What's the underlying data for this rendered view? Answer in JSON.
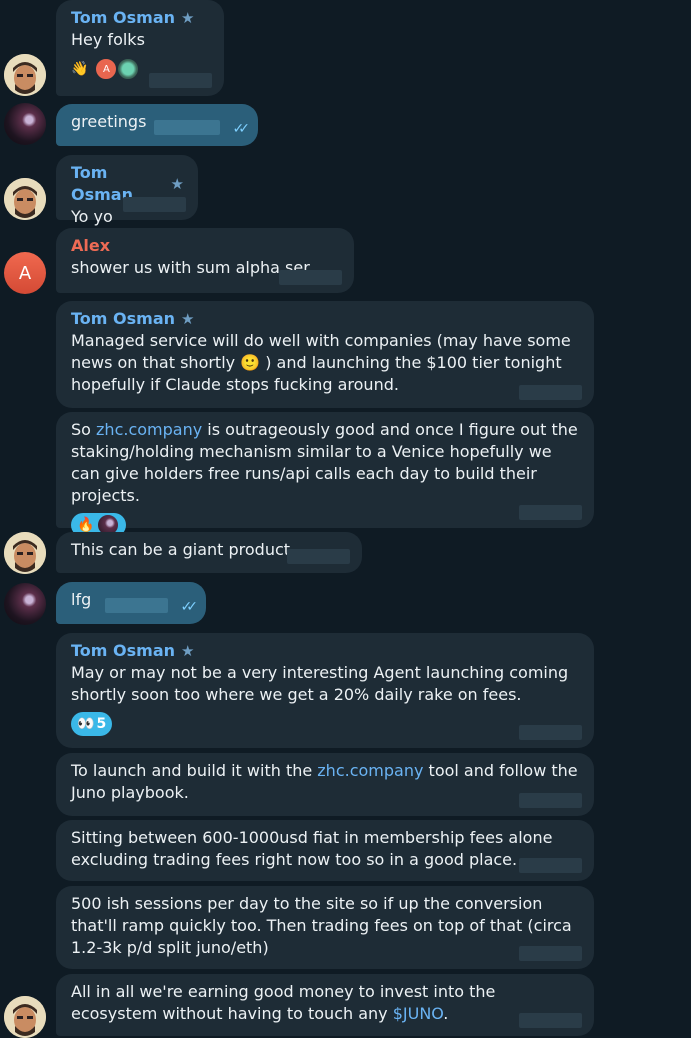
{
  "messages": {
    "m1": {
      "sender": "Tom Osman",
      "text": "Hey folks",
      "reactions": [
        "👋"
      ],
      "reactor_initial": "A"
    },
    "m2": {
      "text": "greetings",
      "read_ticks": "✓✓"
    },
    "m3": {
      "sender": "Tom Osman",
      "text": "Yo yo"
    },
    "m4": {
      "sender": "Alex",
      "text": "shower us with sum alpha ser"
    },
    "m5": {
      "sender": "Tom Osman",
      "text": "Managed service will do well with companies (may have some news on that shortly 🙂 ) and launching the $100 tier tonight hopefully if Claude stops fucking around."
    },
    "m6": {
      "text_before": "So ",
      "link": "zhc.company",
      "text_after": " is outrageously good and once I figure out the staking/holding mechanism similar to a Venice hopefully we can give holders free runs/api calls each day to build their projects.",
      "reaction": "🔥"
    },
    "m7": {
      "text": "This can be a giant product"
    },
    "m8": {
      "text": "lfg",
      "read_ticks": "✓✓"
    },
    "m9": {
      "sender": "Tom Osman",
      "text": "May or may not be a very interesting Agent launching coming shortly soon too where we get a 20% daily rake on fees.",
      "reaction": "👀",
      "reaction_count": "5"
    },
    "m10": {
      "text_before": "To launch and build it with the ",
      "link": "zhc.company",
      "text_after": " tool and follow the Juno playbook."
    },
    "m11": {
      "text": "Sitting between 600-1000usd fiat in membership fees alone excluding trading fees right now too so in a good place."
    },
    "m12": {
      "text": "500 ish sessions per day to the site so if up the conversion that'll ramp quickly too. Then trading fees on top of that (circa 1.2-3k p/d split juno/eth)"
    },
    "m13": {
      "text_before": "All in all we're earning good money to invest into the ecosystem without having to touch any ",
      "link": "$JUNO",
      "text_after": "."
    }
  },
  "avatars": {
    "alex_initial": "A"
  },
  "icons": {
    "star": "★",
    "admin_badge": "star-icon"
  },
  "colors": {
    "background": "#0f1b24",
    "bubble": "#1e2c36",
    "own_bubble": "#2b5f7a",
    "name": "#6ab3f3",
    "alex": "#ee6b55",
    "reaction": "#3ab8e8"
  }
}
